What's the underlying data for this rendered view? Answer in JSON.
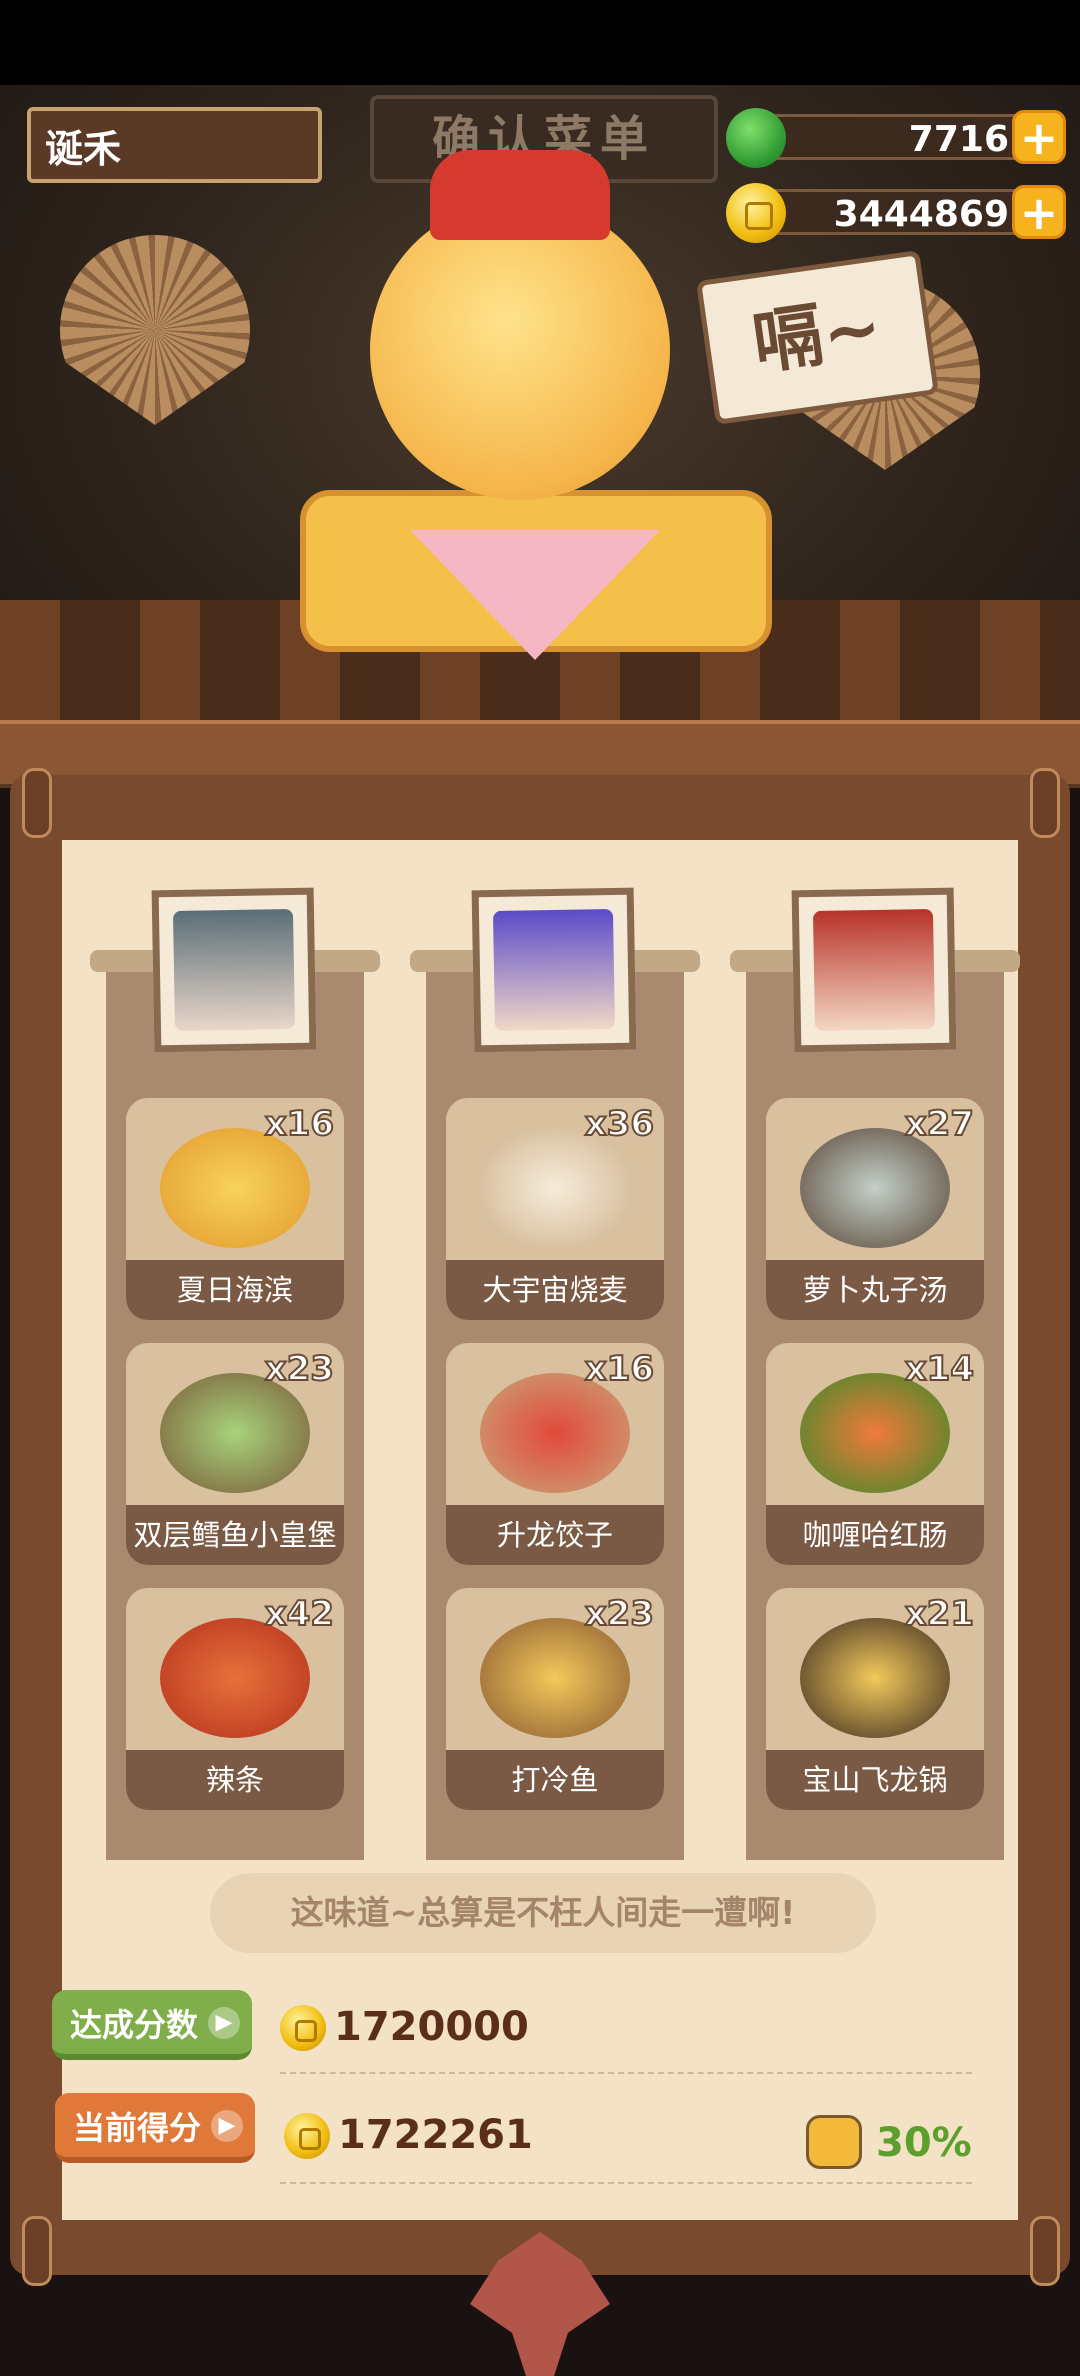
{
  "player": {
    "name": "诞禾"
  },
  "resources": {
    "jade": {
      "value": "7716",
      "icon": "jade-icon"
    },
    "gold": {
      "value": "3444869",
      "icon": "gold-coin-icon"
    }
  },
  "scene": {
    "sign_text": "确认菜单",
    "speech": "嗝~"
  },
  "columns": [
    {
      "portrait": "character-portrait-1",
      "dishes": [
        {
          "name": "夏日海滨",
          "count": "x16"
        },
        {
          "name": "双层鳕鱼小皇堡",
          "count": "x23"
        },
        {
          "name": "辣条",
          "count": "x42"
        }
      ]
    },
    {
      "portrait": "character-portrait-2",
      "dishes": [
        {
          "name": "大宇宙烧麦",
          "count": "x36"
        },
        {
          "name": "升龙饺子",
          "count": "x16"
        },
        {
          "name": "打冷鱼",
          "count": "x23"
        }
      ]
    },
    {
      "portrait": "character-portrait-3",
      "dishes": [
        {
          "name": "萝卜丸子汤",
          "count": "x27"
        },
        {
          "name": "咖喱哈红肠",
          "count": "x14"
        },
        {
          "name": "宝山飞龙锅",
          "count": "x21"
        }
      ]
    }
  ],
  "quote": "这味道~总算是不枉人间走一遭啊!",
  "target": {
    "label": "达成分数",
    "value": "1720000"
  },
  "current": {
    "label": "当前得分",
    "value": "1722261"
  },
  "bonus_percent": "30%",
  "colors": {
    "accent_green": "#5ca02c",
    "accent_orange": "#e0783a",
    "panel": "#f3e2c6"
  }
}
